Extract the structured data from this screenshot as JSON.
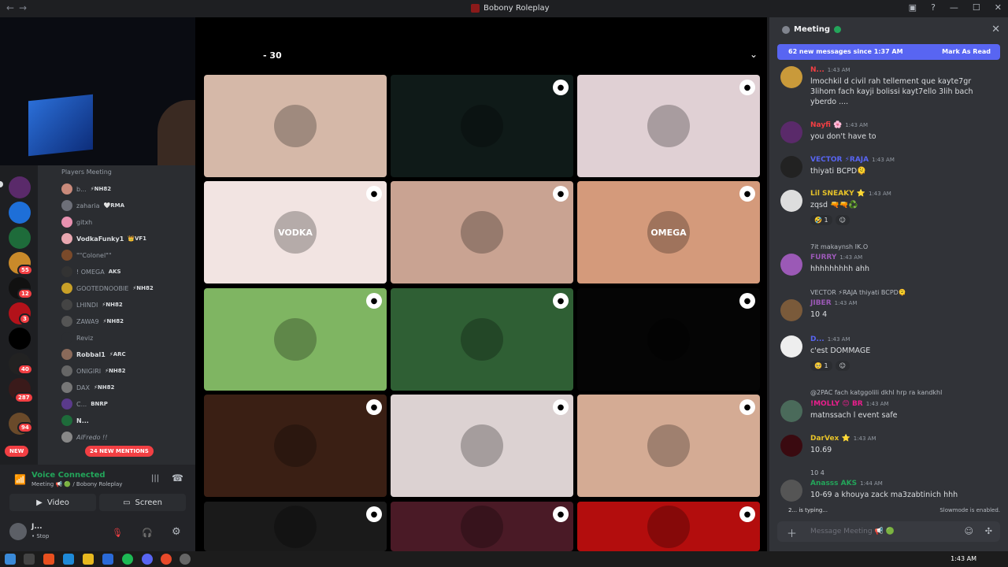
{
  "window": {
    "title": "Bobony Roleplay"
  },
  "rail": {
    "badges": [
      "55",
      "12",
      "3",
      "40",
      "287",
      "94"
    ],
    "new_label": "NEW"
  },
  "channel": {
    "vc_header": "Players Meeting",
    "users": [
      {
        "name": "b...",
        "tag": "⚡NH82"
      },
      {
        "name": "zaharia",
        "tag": "🤍RMA"
      },
      {
        "name": "gitxh",
        "tag": ""
      },
      {
        "name": "VodkaFunky1",
        "tag": "👑VF1"
      },
      {
        "name": "\"\"Colonel\"\"",
        "tag": ""
      },
      {
        "name": "! OMEGA",
        "tag": "AKS"
      },
      {
        "name": "GOOTEDNOOBIE",
        "tag": "⚡NH82"
      },
      {
        "name": "LHINDI",
        "tag": "⚡NH82"
      },
      {
        "name": "ZAWA9",
        "tag": "⚡NH82"
      },
      {
        "name": "Reviz",
        "tag": ""
      },
      {
        "name": "Robbal1",
        "tag": "⚡ARC"
      },
      {
        "name": "ONIGIRI",
        "tag": "⚡NH82"
      },
      {
        "name": "DAX",
        "tag": "⚡NH82"
      },
      {
        "name": "C...",
        "tag": "BNRP"
      },
      {
        "name": "N...",
        "tag": ""
      },
      {
        "name": "AlFredo !!",
        "tag": ""
      }
    ],
    "mentions": "24 NEW MENTIONS"
  },
  "panel": {
    "voice_connected": "Voice Connected",
    "voice_sub": "Meeting 📢 🟢 / Bobony Roleplay",
    "video": "Video",
    "screen": "Screen",
    "user": "J...",
    "user_status": "• Stop"
  },
  "stage": {
    "header": "- 30"
  },
  "tiles": [
    {
      "bg": "#d5b8a8",
      "label": ""
    },
    {
      "bg": "#0f1a18",
      "label": ""
    },
    {
      "bg": "#e0d0d4",
      "label": ""
    },
    {
      "bg": "#f2e4e2",
      "label": "VODKA"
    },
    {
      "bg": "#c9a392",
      "label": ""
    },
    {
      "bg": "#d49a7b",
      "label": "OMEGA"
    },
    {
      "bg": "#7fb562",
      "label": ""
    },
    {
      "bg": "#2f5f34",
      "label": ""
    },
    {
      "bg": "#050505",
      "label": ""
    },
    {
      "bg": "#3a1f14",
      "label": ""
    },
    {
      "bg": "#dcd2d2",
      "label": ""
    },
    {
      "bg": "#d4ab94",
      "label": ""
    },
    {
      "bg": "#1a1a1a",
      "label": ""
    },
    {
      "bg": "#4a1a26",
      "label": ""
    },
    {
      "bg": "#b30d0d",
      "label": ""
    }
  ],
  "chat": {
    "title": "Meeting",
    "banner_left": "62 new messages since 1:37 AM",
    "banner_right": "Mark As Read",
    "messages": [
      {
        "name": "N...",
        "time": "1:43 AM",
        "text": "lmochkil d civil rah tellement que kayte7gr 3lihom fach kayji bolissi kayt7ello 3lih bach yberdo ....",
        "color": "#f23f43"
      },
      {
        "name": "Nayfi 🌸",
        "time": "1:43 AM",
        "text": "you don't have to",
        "color": "#f23f43"
      },
      {
        "name": "VECTOR ⚡RAJA",
        "time": "1:43 AM",
        "text": "thiyati BCPD🫠",
        "color": "#5865f2"
      },
      {
        "name": "Lil SNEAKY ⭐",
        "time": "1:43 AM",
        "text": "zqsd 🔫🔫♻️",
        "color": "#e6c229"
      },
      {
        "name": "FURRY",
        "time": "1:43 AM",
        "text": "hhhhhhhhh ahh",
        "color": "#9b59b6"
      },
      {
        "name": "JIBER",
        "time": "1:43 AM",
        "text": "10 4",
        "color": "#9b59b6"
      },
      {
        "name": "D...",
        "time": "1:43 AM",
        "text": "c'est DOMMAGE",
        "color": "#5865f2"
      },
      {
        "name": "!MOLLY 😊 BR",
        "time": "1:43 AM",
        "text": "matnssach l event safe",
        "color": "#e91e8c"
      },
      {
        "name": "DarVex ⭐",
        "time": "1:43 AM",
        "text": "10.69",
        "color": "#e6c229"
      },
      {
        "name": "Anasss AKS",
        "time": "1:44 AM",
        "text": "10-69 a khouya zack ma3zabtinich hhh",
        "color": "#23a55a"
      }
    ],
    "replies": [
      "7it makaynsh IK.O",
      "VECTOR ⚡RAJA thiyati BCPD🫠",
      "@2PAC fach katggolili dkhl hrp ra kandkhl",
      "10 4"
    ],
    "reactions": [
      "🤣 1",
      "🥺 1"
    ],
    "typing": "2... is typing...",
    "slowmode": "Slowmode is enabled.",
    "input_placeholder": "Message Meeting 📢 🟢"
  },
  "taskbar": {
    "time": "1:43 AM"
  }
}
